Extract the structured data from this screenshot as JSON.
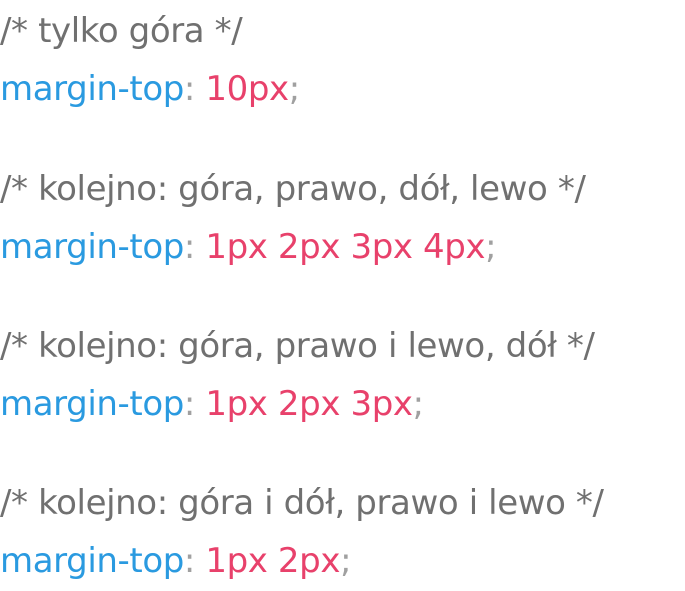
{
  "blocks": [
    {
      "comment": "/* tylko góra */",
      "property": "margin-top",
      "colon": ":",
      "value": "10px",
      "semicolon": ";"
    },
    {
      "comment": "/* kolejno: góra, prawo, dół, lewo */",
      "property": "margin-top",
      "colon": ":",
      "value": "1px 2px 3px 4px",
      "semicolon": ";"
    },
    {
      "comment": "/* kolejno: góra, prawo i lewo, dół */",
      "property": "margin-top",
      "colon": ":",
      "value": "1px 2px 3px",
      "semicolon": ";"
    },
    {
      "comment": "/* kolejno: góra i dół, prawo i lewo */",
      "property": "margin-top",
      "colon": ":",
      "value": "1px 2px",
      "semicolon": ";"
    }
  ],
  "colors": {
    "comment": "#707070",
    "property": "#2a9ae0",
    "punctuation": "#a0a0a0",
    "value": "#e8416b",
    "background": "#ffffff"
  }
}
